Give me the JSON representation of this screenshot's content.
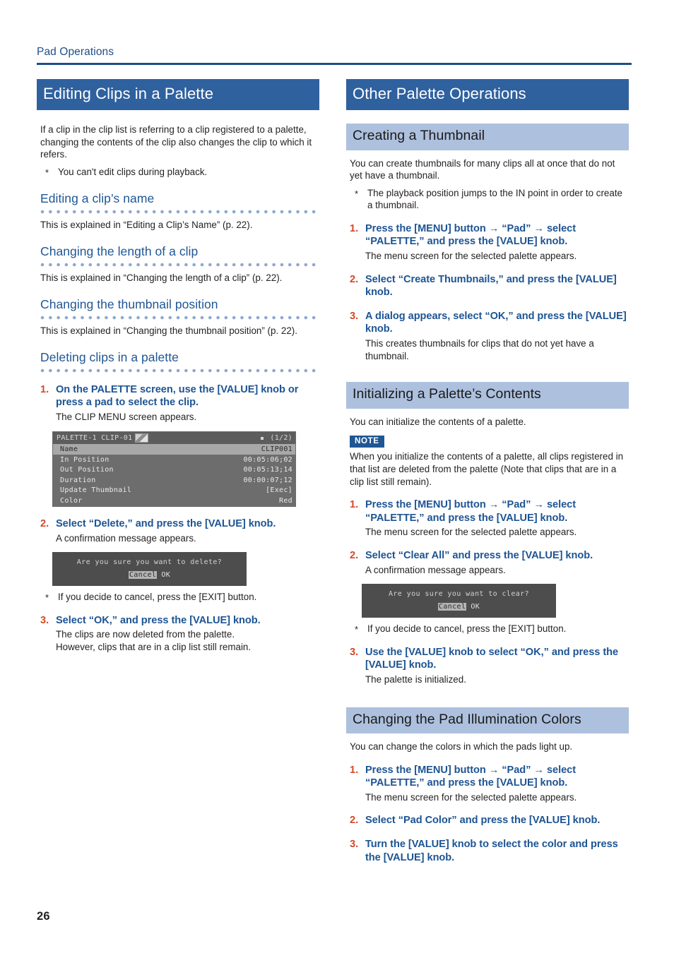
{
  "running_header": {
    "title": "Pad Operations"
  },
  "page_number": "26",
  "colors": {
    "accent_dark_blue": "#2f619f",
    "accent_light_blue": "#adc0de",
    "heading_blue": "#1f5694",
    "step_number_orange": "#d2492a",
    "step_title_blue": "#1d5493",
    "body_text": "#231f20"
  },
  "left_column": {
    "section_heading": "Editing Clips in a Palette",
    "intro": "If a clip in the clip list is referring to a clip registered to a palette, changing the contents of the clip also changes the clip to which it refers.",
    "intro_note": "You can't edit clips during playback.",
    "asterisk": "*",
    "subsections": [
      {
        "heading": "Editing a clip’s name",
        "body": "This is explained in “Editing a Clip’s Name” (p. 22)."
      },
      {
        "heading": "Changing the length of a clip",
        "body": "This is explained in “Changing the length of a clip” (p. 22)."
      },
      {
        "heading": "Changing the thumbnail position",
        "body": "This is explained in “Changing the thumbnail position” (p. 22)."
      }
    ],
    "delete_section": {
      "heading": "Deleting clips in a palette",
      "step1": {
        "num": "1.",
        "title": "On the PALETTE screen, use the [VALUE] knob or press a pad to select the clip.",
        "body": "The CLIP MENU screen appears."
      },
      "step2": {
        "num": "2.",
        "title": "Select “Delete,” and press the [VALUE] knob.",
        "body": "A confirmation message appears."
      },
      "cancel_note": "If you decide to cancel, press the [EXIT] button.",
      "step3": {
        "num": "3.",
        "title": "Select “OK,” and press the [VALUE] knob.",
        "body1": "The clips are now deleted from the palette.",
        "body2": "However, clips that are in a clip list still remain."
      }
    },
    "lcd_clip_menu": {
      "title": "PALETTE-1 CLIP-01",
      "thumb_icon": "thumbnail-icon",
      "page_indicator": "(1/2)",
      "rows": [
        {
          "label": "Name",
          "value": "CLIP001",
          "selected": true
        },
        {
          "label": "In Position",
          "value": "00:05:06;02",
          "selected": false
        },
        {
          "label": "Out Position",
          "value": "00:05:13;14",
          "selected": false
        },
        {
          "label": "Duration",
          "value": "00:00:07;12",
          "selected": false
        },
        {
          "label": "Update Thumbnail",
          "value": "[Exec]",
          "selected": false
        },
        {
          "label": "Color",
          "value": "Red",
          "selected": false
        }
      ]
    },
    "lcd_delete_dialog": {
      "message": "Are you sure you want to delete?",
      "cancel": "Cancel",
      "ok": "OK"
    }
  },
  "right_column": {
    "section_heading": "Other Palette Operations",
    "creating_thumbnail": {
      "heading": "Creating a Thumbnail",
      "intro": "You can create thumbnails for many clips all at once that do not yet have a thumbnail.",
      "note": "The playback position jumps to the IN point in order to create a thumbnail.",
      "step1": {
        "num": "1.",
        "title": "Press the [MENU] button → “Pad” → select “PALETTE,” and press the [VALUE] knob.",
        "body": "The menu screen for the selected palette appears."
      },
      "step2": {
        "num": "2.",
        "title": "Select “Create Thumbnails,” and press the [VALUE] knob."
      },
      "step3": {
        "num": "3.",
        "title": "A dialog appears, select “OK,” and press the [VALUE] knob.",
        "body": "This creates thumbnails for clips that do not yet have a thumbnail."
      }
    },
    "initializing": {
      "heading": "Initializing a Palette’s Contents",
      "intro": "You can initialize the contents of a palette.",
      "note_badge": "NOTE",
      "note_body": "When you initialize the contents of a palette, all clips registered in that list are deleted from the palette (Note that clips that are in a clip list still remain).",
      "step1": {
        "num": "1.",
        "title": "Press the [MENU] button → “Pad” → select “PALETTE,” and press the [VALUE] knob.",
        "body": "The menu screen for the selected palette appears."
      },
      "step2": {
        "num": "2.",
        "title": "Select “Clear All” and press the [VALUE] knob.",
        "body": "A confirmation message appears."
      },
      "cancel_note": "If you decide to cancel, press the [EXIT] button.",
      "step3": {
        "num": "3.",
        "title": "Use the [VALUE] knob to select “OK,” and press the [VALUE] knob.",
        "body": "The palette is initialized."
      },
      "lcd_clear_dialog": {
        "message": "Are you sure you want to clear?",
        "cancel": "Cancel",
        "ok": "OK"
      }
    },
    "pad_colors": {
      "heading": "Changing the Pad Illumination Colors",
      "intro": "You can change the colors in which the pads light up.",
      "step1": {
        "num": "1.",
        "title": "Press the [MENU] button → “Pad” → select “PALETTE,” and press the [VALUE] knob.",
        "body": "The menu screen for the selected palette appears."
      },
      "step2": {
        "num": "2.",
        "title": "Select “Pad Color” and press the [VALUE] knob."
      },
      "step3": {
        "num": "3.",
        "title": "Turn the [VALUE] knob to select the color and press the [VALUE] knob."
      }
    }
  }
}
